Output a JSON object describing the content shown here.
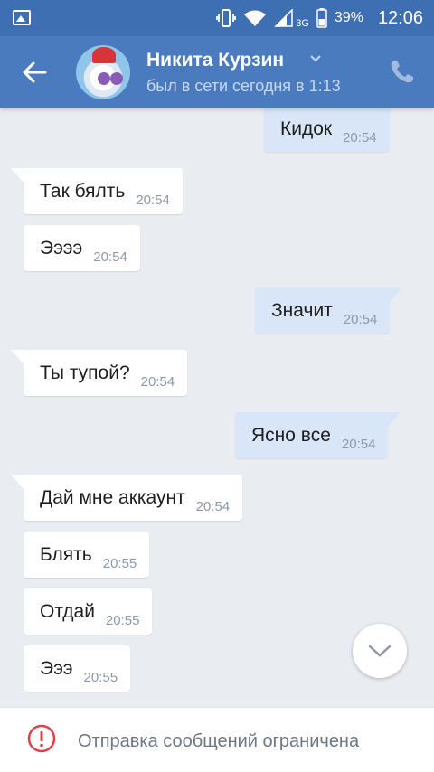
{
  "status_bar": {
    "network": "3G",
    "battery": "39%",
    "time": "12:06",
    "icons": [
      "gallery-icon",
      "vibrate-icon",
      "wifi-icon",
      "signal-icon",
      "battery-icon"
    ]
  },
  "header": {
    "contact_name": "Никита Курзин",
    "last_seen": "был в сети сегодня в 1:13",
    "icons": [
      "back-arrow-icon",
      "chevron-down-icon",
      "phone-icon"
    ]
  },
  "messages": [
    {
      "text": "Кидок",
      "time": "20:54",
      "direction": "out"
    },
    {
      "text": "Так бялть",
      "time": "20:54",
      "direction": "in"
    },
    {
      "text": "Ээээ",
      "time": "20:54",
      "direction": "in"
    },
    {
      "text": "Значит",
      "time": "20:54",
      "direction": "out"
    },
    {
      "text": "Ты тупой?",
      "time": "20:54",
      "direction": "in"
    },
    {
      "text": "Ясно все",
      "time": "20:54",
      "direction": "out"
    },
    {
      "text": "Дай мне аккаунт",
      "time": "20:54",
      "direction": "in"
    },
    {
      "text": "Блять",
      "time": "20:55",
      "direction": "in"
    },
    {
      "text": "Отдай",
      "time": "20:55",
      "direction": "in"
    },
    {
      "text": "Эээ",
      "time": "20:55",
      "direction": "in"
    }
  ],
  "footer": {
    "restriction_text": "Отправка сообщений ограничена",
    "icon": "warning-icon",
    "accent_color": "#e0404a"
  },
  "colors": {
    "header": "#4b7bbf",
    "status_bar": "#3f6fb3",
    "outgoing_bubble": "#d8e6f7",
    "incoming_bubble": "#ffffff",
    "background": "#e9edf2"
  }
}
